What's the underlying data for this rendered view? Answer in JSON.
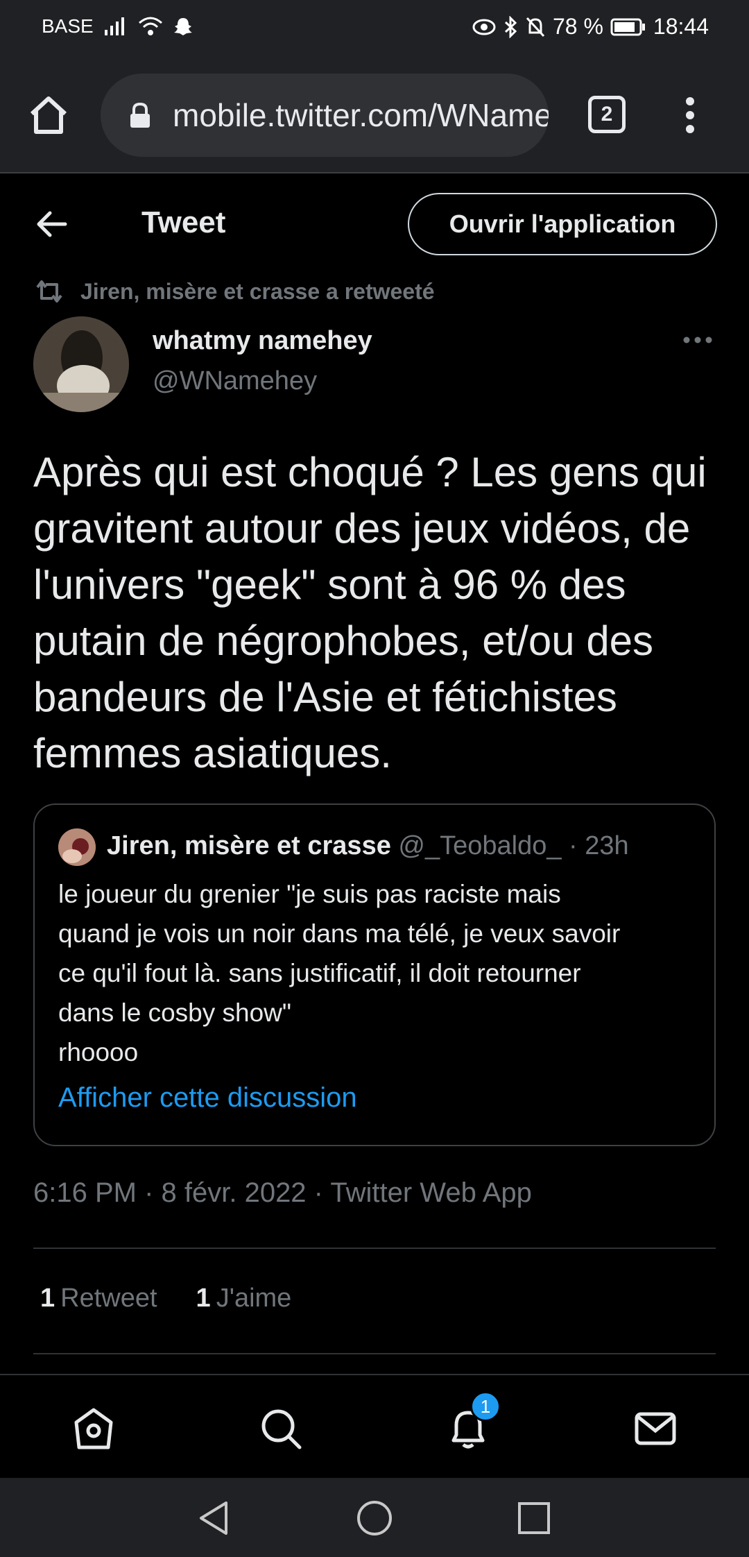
{
  "status_bar": {
    "carrier": "BASE",
    "battery": "78 %",
    "time": "18:44"
  },
  "browser": {
    "url": "mobile.twitter.com/WNamehey",
    "tab_count": "2"
  },
  "header": {
    "title": "Tweet",
    "open_app_label": "Ouvrir l'application"
  },
  "tweet": {
    "retweeted_by": "Jiren, misère et crasse a retweeté",
    "author_name": "whatmy namehey",
    "author_handle": "@WNamehey",
    "text": "Après qui est choqué ? Les gens qui gravitent autour des jeux vidéos, de l'univers \"geek\" sont à 96 % des putain de négrophobes, et/ou des bandeurs de l'Asie et fétichistes femmes asiatiques.",
    "timestamp": "6:16 PM · 8 févr. 2022 · Twitter Web App",
    "retweet_count": "1",
    "retweet_label": "Retweet",
    "like_count": "1",
    "like_label": "J'aime"
  },
  "quote": {
    "author_name": "Jiren, misère et crasse",
    "meta": "@_Teobaldo_ · 23h",
    "text_lines": [
      "le joueur du grenier \"je suis pas raciste mais",
      "quand je vois un noir dans ma télé, je veux savoir",
      "ce qu'il fout là. sans justificatif, il doit retourner",
      "dans le cosby show\"",
      "rhoooo"
    ],
    "link": "Afficher cette discussion"
  },
  "tabbar": {
    "notification_badge": "1",
    "icons": [
      "home-icon",
      "search-icon",
      "bell-icon",
      "mail-icon"
    ]
  },
  "colors": {
    "accent": "#1d9bf0",
    "background": "#000000",
    "muted_text": "#71767b"
  }
}
